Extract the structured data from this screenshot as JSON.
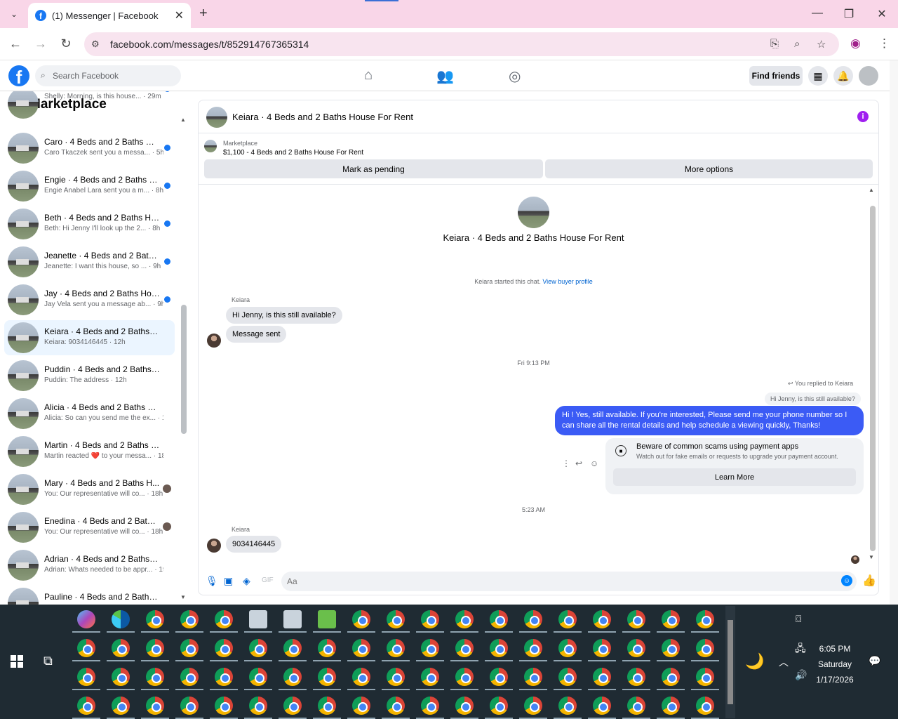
{
  "browser": {
    "tab_title": "(1) Messenger | Facebook",
    "url": "facebook.com/messages/t/852914767365314"
  },
  "fb": {
    "search_placeholder": "Search Facebook",
    "find_friends": "Find friends"
  },
  "sidebar": {
    "title": "Marketplace",
    "conversations": [
      {
        "name": "",
        "preview": "Shelly: Morning, is this house... · 29m",
        "unread": true
      },
      {
        "name": "Caro · 4 Beds and 2 Baths Ho...",
        "preview": "Caro Tkaczek sent you a messa... · 5h",
        "unread": true
      },
      {
        "name": "Engie · 4 Beds and 2 Baths Ho...",
        "preview": "Engie Anabel Lara sent you a m... · 8h",
        "unread": true
      },
      {
        "name": "Beth · 4 Beds and 2 Baths Ho...",
        "preview": "Beth: Hi Jenny I'll look up the 2... · 8h",
        "unread": true
      },
      {
        "name": "Jeanette · 4 Beds and 2 Baths ...",
        "preview": "Jeanette: I want this house, so ... · 9h",
        "unread": true
      },
      {
        "name": "Jay · 4 Beds and 2 Baths Hous...",
        "preview": "Jay Vela sent you a message ab... · 9h",
        "unread": true
      },
      {
        "name": "Keiara · 4 Beds and 2 Baths Ho...",
        "preview": "Keiara: 9034146445 · 12h",
        "unread": false
      },
      {
        "name": "Puddin · 4 Beds and 2 Baths Ho...",
        "preview": "Puddin: The address · 12h",
        "unread": false
      },
      {
        "name": "Alicia · 4 Beds and 2 Baths Hou...",
        "preview": "Alicia: So can you send me the ex... · 18h",
        "unread": false
      },
      {
        "name": "Martin · 4 Beds and 2 Baths Ho...",
        "preview": "Martin reacted ❤️ to your messa... · 18h",
        "unread": false
      },
      {
        "name": "Mary · 4 Beds and 2 Baths H...",
        "preview": "You: Our representative will co... · 18h",
        "unread": false
      },
      {
        "name": "Enedina · 4 Beds and 2 Baths ...",
        "preview": "You: Our representative will co... · 18h",
        "unread": false
      },
      {
        "name": "Adrian · 4 Beds and 2 Baths Ho...",
        "preview": "Adrian: Whats needed to be appr... · 19h",
        "unread": false
      },
      {
        "name": "Pauline · 4 Beds and 2 Baths ...",
        "preview": "",
        "unread": false
      }
    ]
  },
  "chat": {
    "header_title": "Keiara · 4 Beds and 2 Baths House For Rent",
    "marketplace_label": "Marketplace",
    "listing": "$1,100 - 4 Beds and 2 Baths House For Rent",
    "mark_pending": "Mark as pending",
    "more_options": "More options",
    "intro_title": "Keiara · 4 Beds and 2 Baths House For Rent",
    "started_text": "Keiara started this chat.",
    "view_buyer": "View buyer profile",
    "sender1": "Keiara",
    "msg1": "Hi Jenny, is this still available?",
    "msg2": "Message sent",
    "ts1": "Fri 9:13 PM",
    "replied": "You replied to Keiara",
    "quoted": "Hi Jenny, is this still available?",
    "reply": "Hi ! Yes, still available. If you're interested, Please send me your phone number so I can share all the rental details and help schedule a viewing quickly, Thanks!",
    "warn_title": "Beware of common scams using payment apps",
    "warn_sub": "Watch out for fake emails or requests to upgrade your payment account.",
    "learn_more": "Learn More",
    "ts2": "5:23 AM",
    "sender2": "Keiara",
    "msg3": "9034146445",
    "composer_placeholder": "Aa"
  },
  "taskbar": {
    "time": "6:05 PM",
    "day": "Saturday",
    "date": "1/17/2026"
  }
}
